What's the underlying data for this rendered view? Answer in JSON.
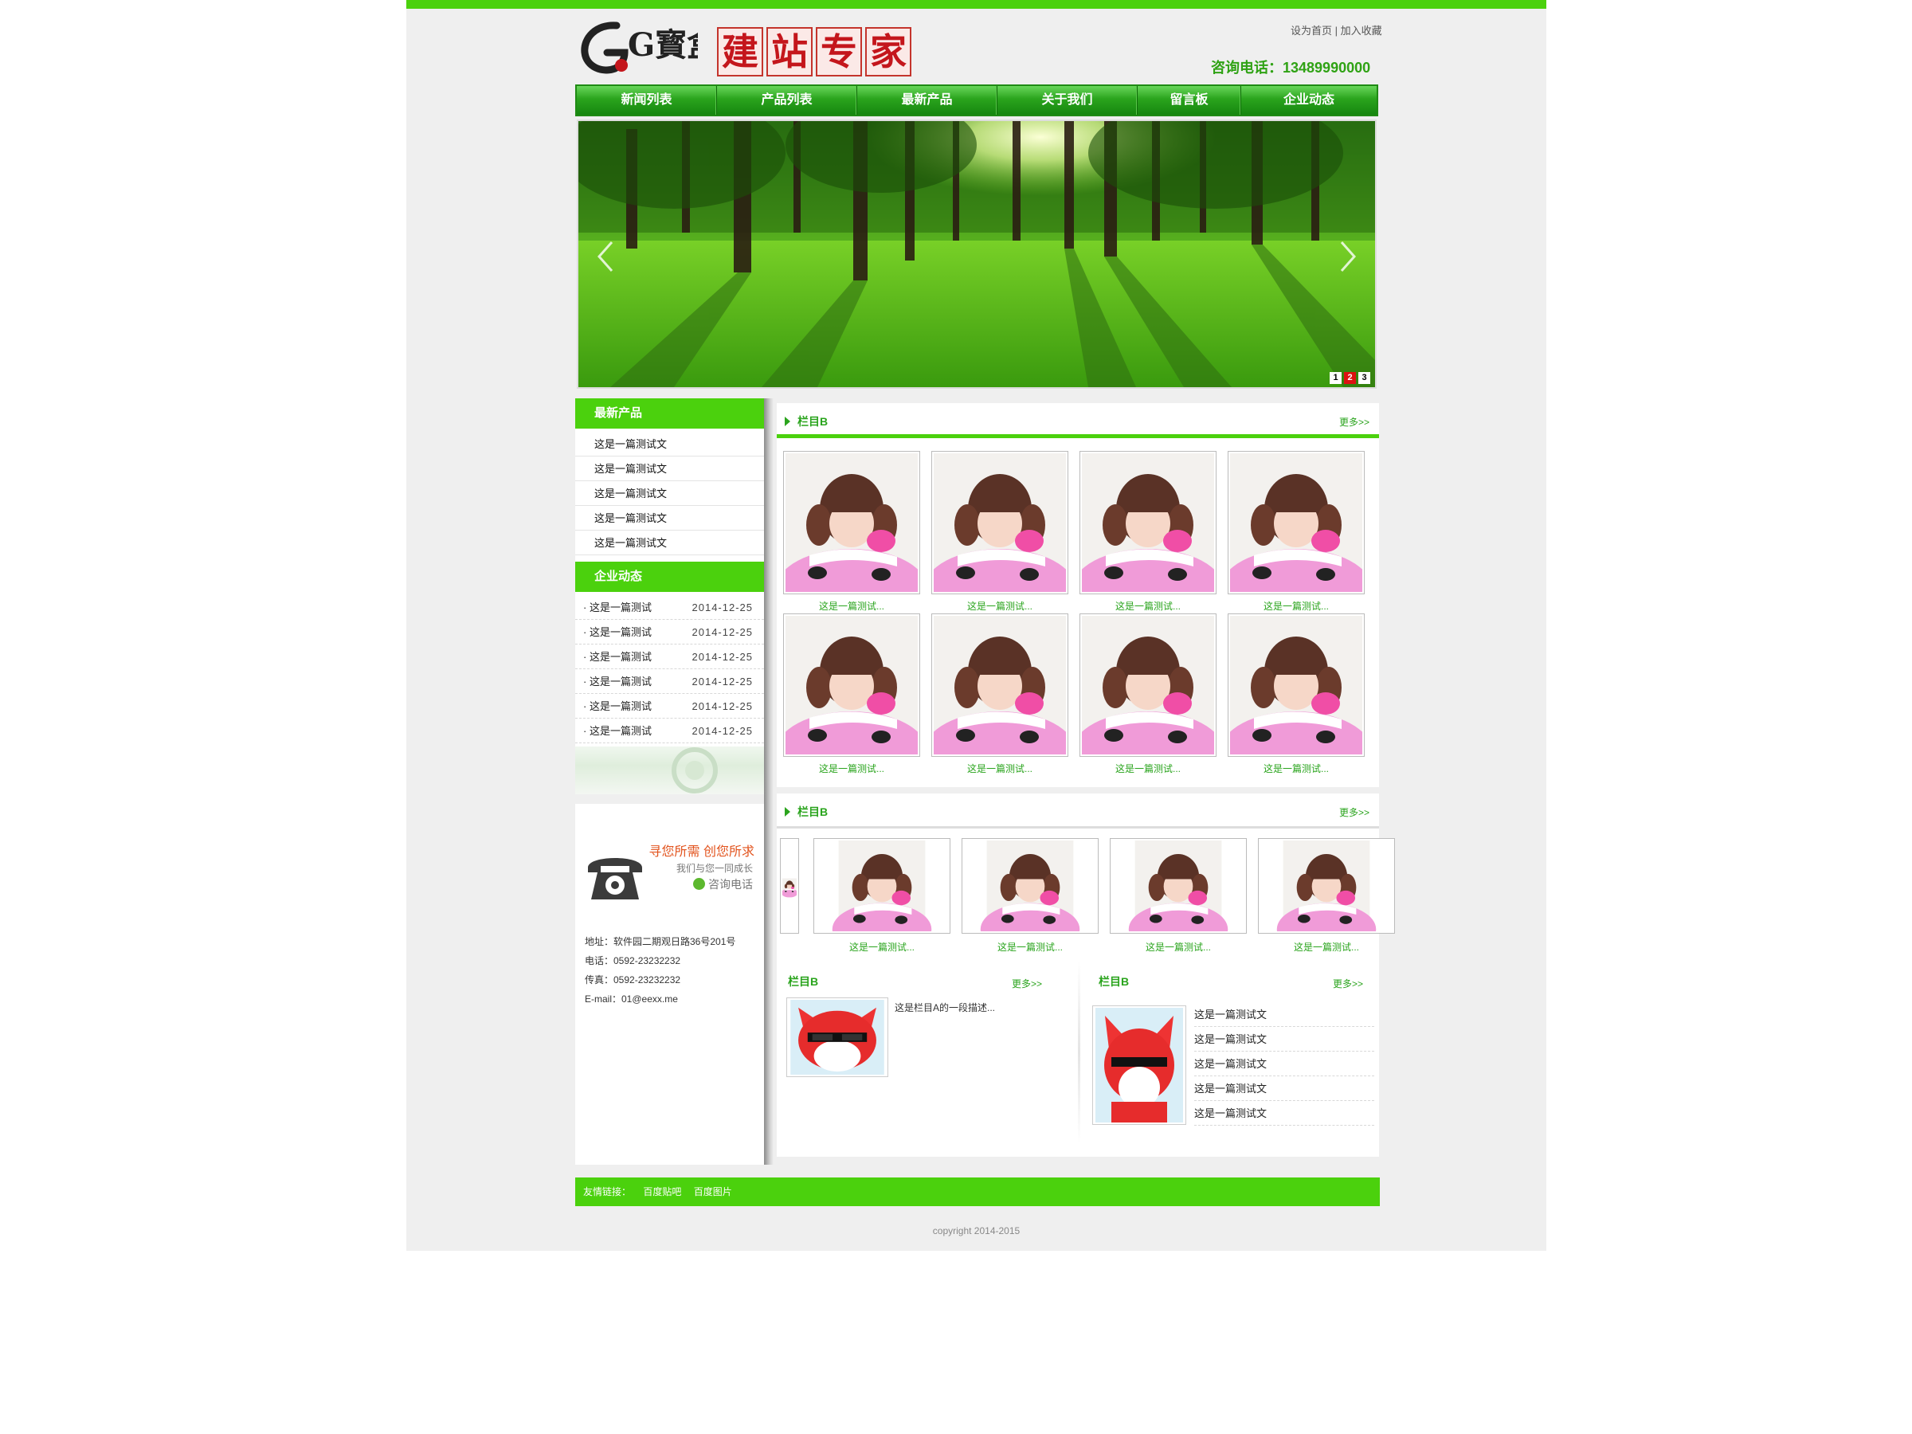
{
  "header": {
    "logo_text": "G寳盒",
    "logo_seal_chars": [
      "建",
      "站",
      "专",
      "家"
    ],
    "toplinks": [
      "设为首页",
      "加入收藏"
    ],
    "hotline": "咨询电话：13489990000"
  },
  "nav": {
    "items": [
      "新闻列表",
      "产品列表",
      "最新产品",
      "关于我们",
      "留言板",
      "企业动态"
    ]
  },
  "banner": {
    "dots": [
      "1",
      "2",
      "3"
    ],
    "active_dot": 2,
    "prev_icon": "chevron-left-icon",
    "next_icon": "chevron-right-icon"
  },
  "sidebar": {
    "products_title": "最新产品",
    "products": [
      "这是一篇测试文",
      "这是一篇测试文",
      "这是一篇测试文",
      "这是一篇测试文",
      "这是一篇测试文"
    ],
    "news_title": "企业动态",
    "news": [
      {
        "title": "这是一篇测试",
        "date": "2014-12-25"
      },
      {
        "title": "这是一篇测试",
        "date": "2014-12-25"
      },
      {
        "title": "这是一篇测试",
        "date": "2014-12-25"
      },
      {
        "title": "这是一篇测试",
        "date": "2014-12-25"
      },
      {
        "title": "这是一篇测试",
        "date": "2014-12-25"
      },
      {
        "title": "这是一篇测试",
        "date": "2014-12-25"
      }
    ],
    "contact": {
      "slogan": "寻您所需  创您所求",
      "slogan2": "我们与您一同成长",
      "consult": "咨询电话",
      "address": "地址：软件园二期观日路36号201号",
      "phone": "电话：0592-23232232",
      "fax": "传真：0592-23232232",
      "email": "E-mail：01@eexx.me"
    }
  },
  "section1": {
    "title": "栏目B",
    "more": "更多>>",
    "captions": [
      "这是一篇测试...",
      "这是一篇测试...",
      "这是一篇测试...",
      "这是一篇测试...",
      "这是一篇测试...",
      "这是一篇测试...",
      "这是一篇测试...",
      "这是一篇测试..."
    ]
  },
  "section2": {
    "title": "栏目B",
    "more": "更多>>",
    "captions": [
      "这是一篇测试...",
      "这是一篇测试...",
      "这是一篇测试...",
      "这是一篇测试..."
    ]
  },
  "section3": {
    "left_title": "栏目B",
    "left_more": "更多>>",
    "left_desc": "这是栏目A的一段描述...",
    "right_title": "栏目B",
    "right_more": "更多>>",
    "right_list": [
      "这是一篇测试文",
      "这是一篇测试文",
      "这是一篇测试文",
      "这是一篇测试文",
      "这是一篇测试文"
    ]
  },
  "footer": {
    "friend_label": "友情链接：",
    "links": [
      "百度贴吧",
      "百度图片"
    ],
    "copyright": "copyright 2014-2015"
  },
  "colors": {
    "brand_green": "#4bd10d",
    "nav_green": "#2aa41d",
    "accent_orange": "#e2531d"
  }
}
